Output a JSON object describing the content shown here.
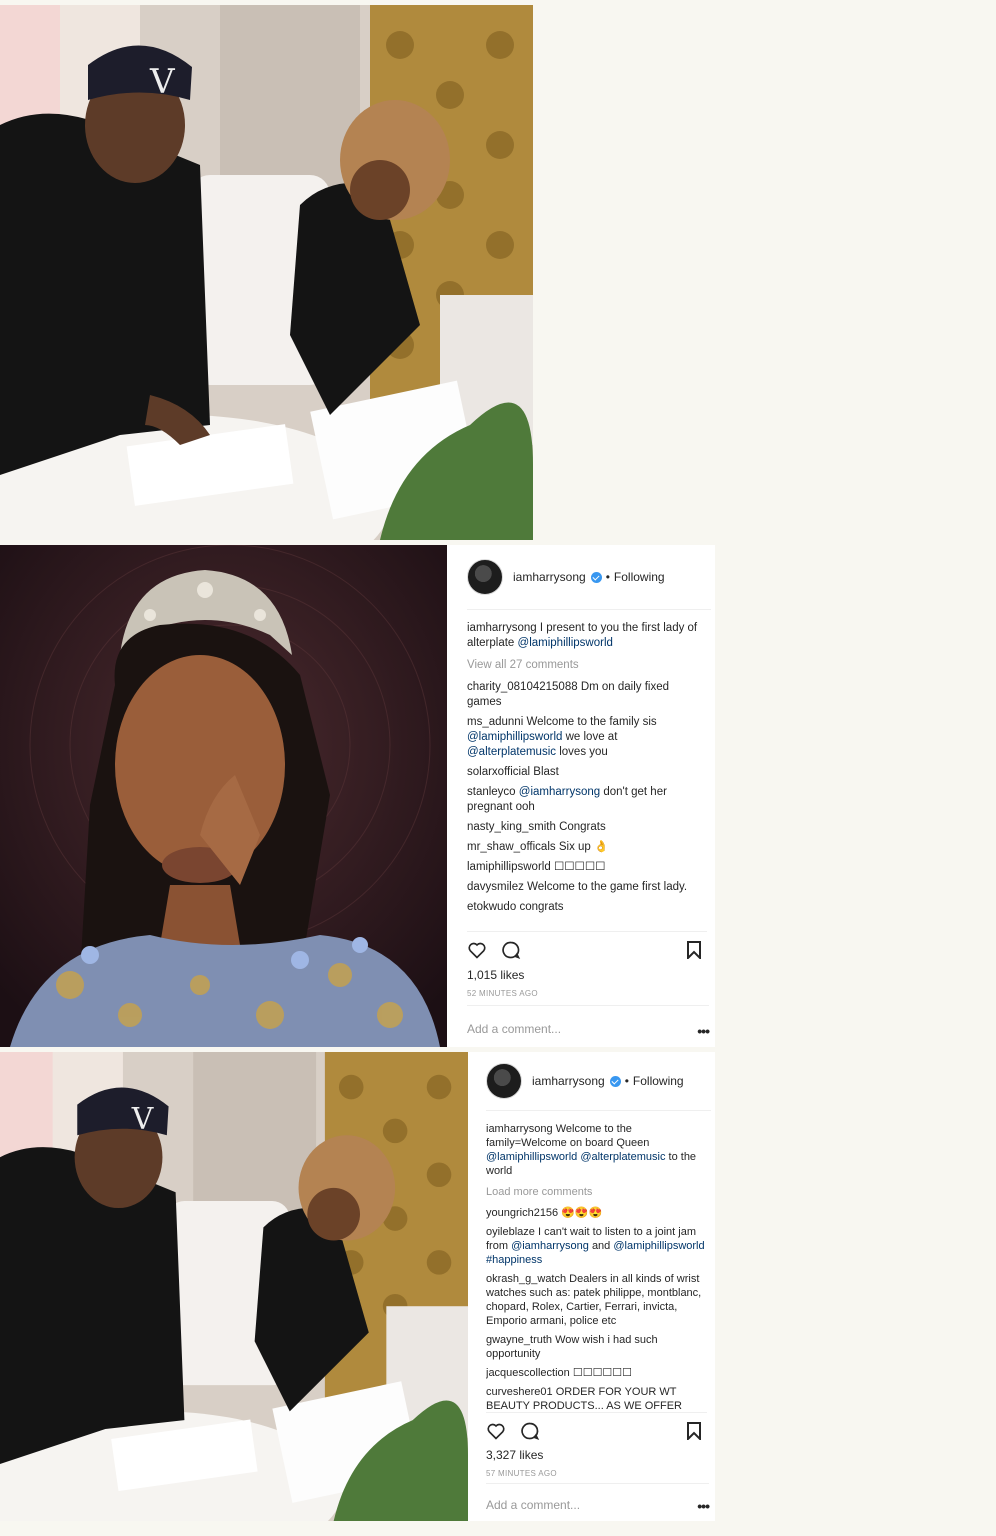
{
  "post1": {
    "username": "iamharrysong",
    "following": "Following",
    "caption_user": "iamharrysong",
    "caption_text": "I present to you the first lady of alterplate",
    "caption_mention": "@lamiphillipsworld",
    "view_all": "View all 27 comments",
    "comments": [
      {
        "user": "charity_08104215088",
        "text": "Dm on daily fixed games"
      },
      {
        "user": "ms_adunni",
        "text": "Welcome to the family sis",
        "mention": "@lamiphillipsworld",
        "after": "we love at",
        "mention2": "@alterplatemusic",
        "after2": "loves you"
      },
      {
        "user": "solarxofficial",
        "text": "Blast"
      },
      {
        "user": "stanleyco",
        "mention": "@iamharrysong",
        "after": "don't get her pregnant ooh"
      },
      {
        "user": "nasty_king_smith",
        "text": "Congrats"
      },
      {
        "user": "mr_shaw_officals",
        "text": "Six up 👌"
      },
      {
        "user": "lamiphillipsworld",
        "text": "☐☐☐☐☐"
      },
      {
        "user": "davysmilez",
        "text": "Welcome to the game first lady."
      },
      {
        "user": "etokwudo",
        "text": "congrats"
      }
    ],
    "likes": "1,015 likes",
    "time": "52 MINUTES AGO",
    "add_comment": "Add a comment...",
    "more": "•••"
  },
  "post2": {
    "username": "iamharrysong",
    "following": "Following",
    "caption_user": "iamharrysong",
    "caption_text": "Welcome to the family=Welcome on board Queen",
    "caption_mention": "@lamiphillipsworld",
    "caption_mention2": "@alterplatemusic",
    "caption_after": "to the world",
    "view_all": "Load more comments",
    "comments": [
      {
        "user": "youngrich2156",
        "text": "😍😍😍"
      },
      {
        "user": "oyileblaze",
        "text": "I can't wait to listen to a joint jam from",
        "mention": "@iamharrysong",
        "after": "and",
        "mention2": "@lamiphillipsworld",
        "after2": "#happiness"
      },
      {
        "user": "okrash_g_watch",
        "text": "Dealers in all kinds of wrist watches such as: patek philippe, montblanc, chopard, Rolex, Cartier, Ferrari, invicta, Emporio armani, police etc"
      },
      {
        "user": "gwayne_truth",
        "text": "Wow wish i had such opportunity"
      },
      {
        "user": "jacquescollection",
        "text": "☐☐☐☐☐☐"
      },
      {
        "user": "curveshere01",
        "text": "ORDER FOR YOUR WT BEAUTY PRODUCTS... AS WE OFFER"
      }
    ],
    "likes": "3,327 likes",
    "time": "57 MINUTES AGO",
    "add_comment": "Add a comment...",
    "more": "•••"
  },
  "icons": [
    "heart-icon",
    "comment-icon",
    "bookmark-icon",
    "verified-badge-icon"
  ]
}
